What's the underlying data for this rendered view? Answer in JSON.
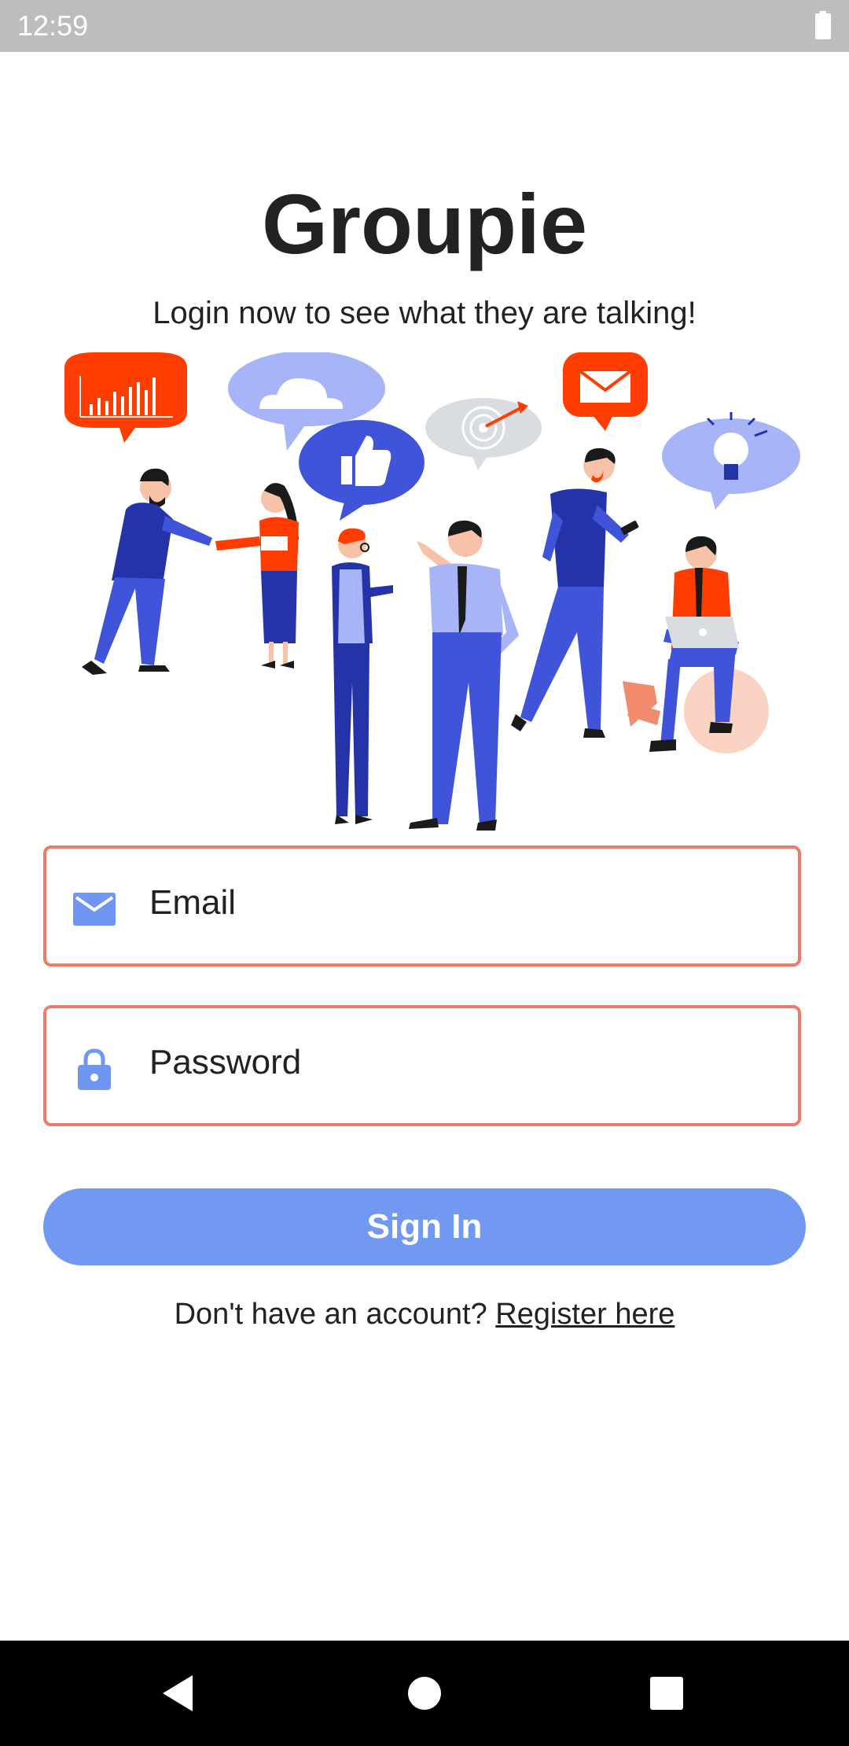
{
  "status_bar": {
    "time": "12:59"
  },
  "app": {
    "title": "Groupie",
    "subtitle": "Login now to see what they are talking!"
  },
  "form": {
    "email_placeholder": "Email",
    "password_placeholder": "Password",
    "signin_label": "Sign In",
    "register_prompt": "Don't have an account?",
    "register_link": "Register here"
  },
  "colors": {
    "field_border": "#ea7d6a",
    "button": "#7299f2",
    "icon": "#6f97f1",
    "accent_orange": "#ff3d00",
    "figure_blue": "#3f54d9",
    "figure_dark_blue": "#2433a8",
    "bubble_light": "#a7b4f7"
  },
  "icons": {
    "email": "mail-icon",
    "password": "lock-icon",
    "battery": "battery-icon",
    "nav_back": "back-triangle-icon",
    "nav_home": "home-circle-icon",
    "nav_recent": "recents-square-icon"
  }
}
